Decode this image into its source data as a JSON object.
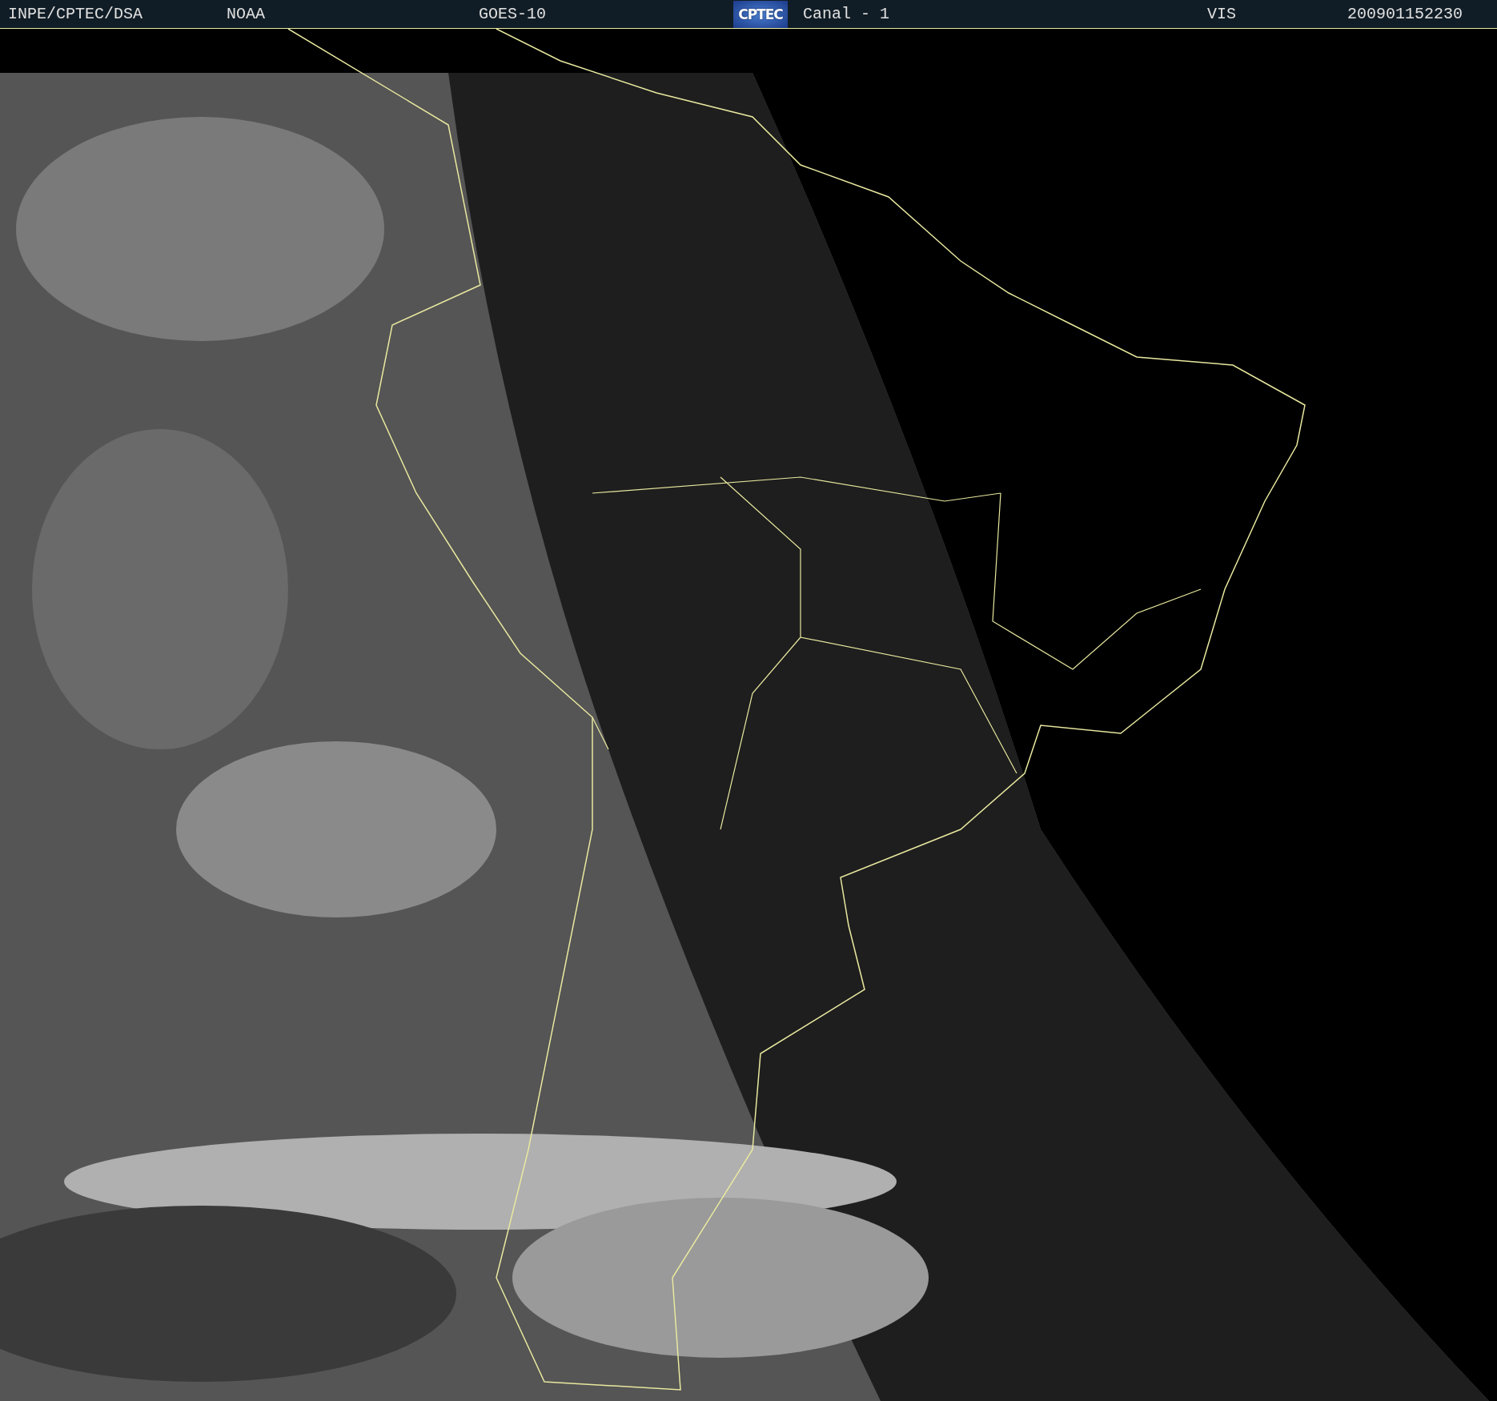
{
  "header": {
    "items": [
      {
        "kind": "text",
        "label": "INPE/CPTEC/DSA"
      },
      {
        "kind": "text",
        "label": "NOAA"
      },
      {
        "kind": "text",
        "label": "GOES-10"
      },
      {
        "kind": "logo",
        "label": "CPTEC"
      },
      {
        "kind": "text",
        "label": "Canal - 1"
      },
      {
        "kind": "text",
        "label": "VIS"
      },
      {
        "kind": "text",
        "label": "200901152230"
      }
    ]
  }
}
